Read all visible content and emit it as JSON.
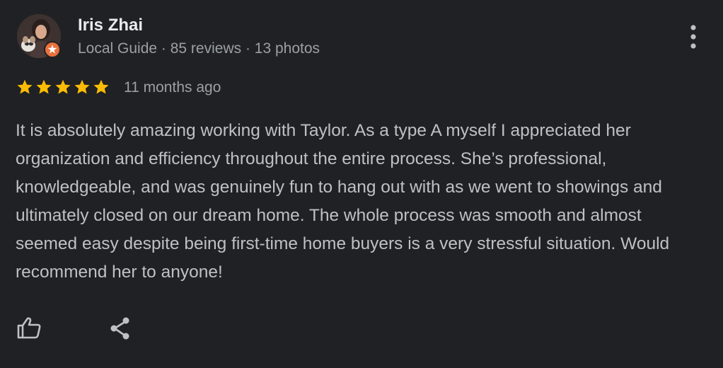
{
  "reviewer": {
    "name": "Iris Zhai",
    "meta": "Local Guide · 85 reviews · 13 photos",
    "avatar_icon": "user-photo",
    "badge_icon": "local-guide-star-icon"
  },
  "review": {
    "rating": 5,
    "rating_max": 5,
    "date": "11 months ago",
    "text": "It is absolutely amazing working with Taylor. As a type A myself I appreciated her organization and efficiency throughout the entire process. She’s professional, knowledgeable, and was genuinely fun to hang out with as we went to showings and ultimately closed on our dream home. The whole process was smooth and almost seemed easy despite being first-time home buyers is a very stressful situation. Would recommend her to anyone!"
  },
  "actions": {
    "more_icon": "more-vert-icon",
    "like_icon": "thumbs-up-icon",
    "share_icon": "share-icon"
  },
  "colors": {
    "background": "#202124",
    "star": "#fbbc04",
    "badge": "#e8713c",
    "text_primary": "#e8eaed",
    "text_secondary": "#9aa0a6",
    "text_body": "#bdc1c6"
  }
}
